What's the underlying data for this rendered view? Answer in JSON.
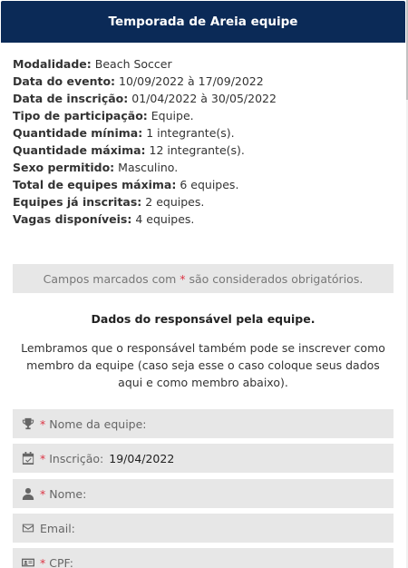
{
  "header": {
    "title": "Temporada de Areia equipe"
  },
  "details": [
    {
      "label": "Modalidade:",
      "value": "Beach Soccer"
    },
    {
      "label": "Data do evento:",
      "value": "10/09/2022 à 17/09/2022"
    },
    {
      "label": "Data de inscrição:",
      "value": "01/04/2022 à 30/05/2022"
    },
    {
      "label": "Tipo de participação:",
      "value": "Equipe."
    },
    {
      "label": "Quantidade mínima:",
      "value": "1 integrante(s)."
    },
    {
      "label": "Quantidade máxima:",
      "value": "12 integrante(s)."
    },
    {
      "label": "Sexo permitido:",
      "value": "Masculino."
    },
    {
      "label": "Total de equipes máxima:",
      "value": "6 equipes."
    },
    {
      "label": "Equipes já inscritas:",
      "value": "2 equipes."
    },
    {
      "label": "Vagas disponíveis:",
      "value": "4 equipes."
    }
  ],
  "note": {
    "prefix": "Campos marcados com ",
    "star": "*",
    "suffix": " são considerados obrigatórios."
  },
  "section": {
    "title": "Dados do responsável pela equipe.",
    "text": "Lembramos que o responsável também pode se inscrever como membro da equipe (caso seja esse o caso coloque seus dados aqui e como membro abaixo)."
  },
  "fields": {
    "team_name": {
      "star": "*",
      "label": "Nome da equipe:",
      "icon": "trophy-icon"
    },
    "inscricao": {
      "star": "*",
      "label": "Inscrição:",
      "value": "19/04/2022",
      "icon": "calendar-check-icon"
    },
    "nome": {
      "star": "*",
      "label": "Nome:",
      "icon": "user-icon"
    },
    "email": {
      "label": "Email:",
      "icon": "envelope-icon"
    },
    "cpf": {
      "star": "*",
      "label": "CPF:",
      "icon": "id-card-icon"
    }
  },
  "colors": {
    "header_bg": "#0b2a57",
    "required": "#dc3545",
    "field_bg": "#e7e7e7"
  }
}
